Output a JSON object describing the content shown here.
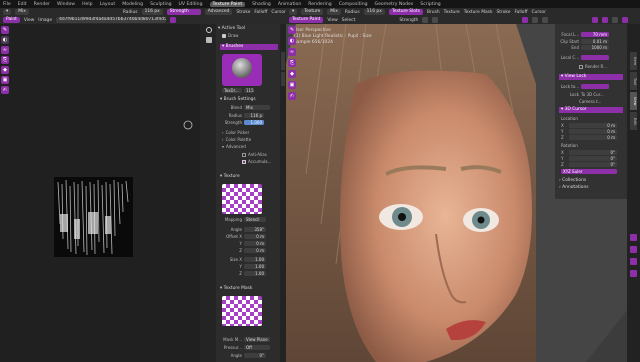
{
  "menubar": {
    "items": [
      "File",
      "Edit",
      "Render",
      "Window",
      "Help",
      "Layout",
      "Modeling",
      "Sculpting",
      "UV Editing",
      "Texture Paint",
      "Shading",
      "Animation",
      "Rendering",
      "Compositing",
      "Geometry Nodes",
      "Scripting"
    ],
    "active_index": 9
  },
  "image_header": {
    "mode": "Paint",
    "menus": [
      "View",
      "Image"
    ],
    "image_name": "4d7f9b11d99d3f4a4a4d57bb3740b4d80713f4d5.jpg",
    "blend": "Mix",
    "radius": "Radius",
    "radius_val": "116 px",
    "strength": "Strength",
    "strength_val": "1.000",
    "menus2": [
      "Advanced",
      "Stroke",
      "Falloff",
      "Cursor"
    ]
  },
  "viewport_header": {
    "mode": "Texture Paint",
    "menus": [
      "View",
      "Select"
    ],
    "texture": "Texture",
    "blend": "Mix",
    "radius": "Radius",
    "radius_val": "116 px",
    "strength": "Strength",
    "brush": "Texture Slots",
    "menus2": [
      "Brush",
      "Texture",
      "Texture Mask",
      "Stroke",
      "Falloff",
      "Cursor"
    ]
  },
  "sidebar": {
    "active_tool": "Active Tool",
    "draw": "Draw",
    "brushes": "Brushes",
    "brush_name": "TexDr...",
    "brush_count": "115",
    "brush_settings": "Brush Settings",
    "blend_label": "Blend",
    "blend": "Mix",
    "radius_label": "Radius",
    "radius": "116 p",
    "strength_label": "Strength",
    "strength": "1.000",
    "color_picker": "Color Picker",
    "color_palette": "Color Palette",
    "advanced": "Advanced",
    "anti_alias": "Anti-Alias",
    "accumulate": "Accumula...",
    "texture": "Texture",
    "mapping_label": "Mapping",
    "mapping": "Stencil",
    "angle_label": "Angle",
    "angle": "358°",
    "offset_label": "Offset X",
    "offset_x": "0 m",
    "y_label": "Y",
    "offset_y": "0 m",
    "z_label": "Z",
    "offset_z": "0 m",
    "size_label": "Size X",
    "size_x": "1.00",
    "size_y": "1.00",
    "size_z": "1.00",
    "texture_mask": "Texture Mask",
    "mask_mapping_label": "Mask M...",
    "mask_mapping": "View Plane",
    "pressure_label": "Pressur...",
    "pressure": "Off",
    "mask_angle_label": "Angle",
    "mask_angle": "0°"
  },
  "viewport": {
    "perspective": "User Perspective",
    "collection": "(1) Blue Light Realistic : Pupil : Size",
    "sample": "Sample 656/1024"
  },
  "npanel": {
    "focal_label": "Focal L...",
    "focal": "70 mm",
    "clip_start_label": "Clip Start",
    "clip_start": "0.01 m",
    "end_label": "End",
    "clip_end": "1000 m",
    "local_camera": "Local C...",
    "render_region": "Render R...",
    "view_lock": "View Lock",
    "lock_to_object": "Lock to...",
    "lock_label": "Lock",
    "to_3d_cursor": "To 3D Cur...",
    "camera_to_view": "Camera t...",
    "cursor_title": "3D Cursor",
    "location": "Location",
    "x": "X",
    "y": "Y",
    "z": "Z",
    "loc_x": "0 m",
    "loc_y": "0 m",
    "loc_z": "0 m",
    "rotation": "Rotation",
    "rot_x": "0°",
    "rot_y": "0°",
    "rot_z": "0°",
    "rotation_mode": "XYZ Euler",
    "collections": "Collections",
    "annotations": "Annotations",
    "view_title": "View"
  },
  "right_tabs": [
    "Item",
    "Tool",
    "View",
    "Edit"
  ]
}
